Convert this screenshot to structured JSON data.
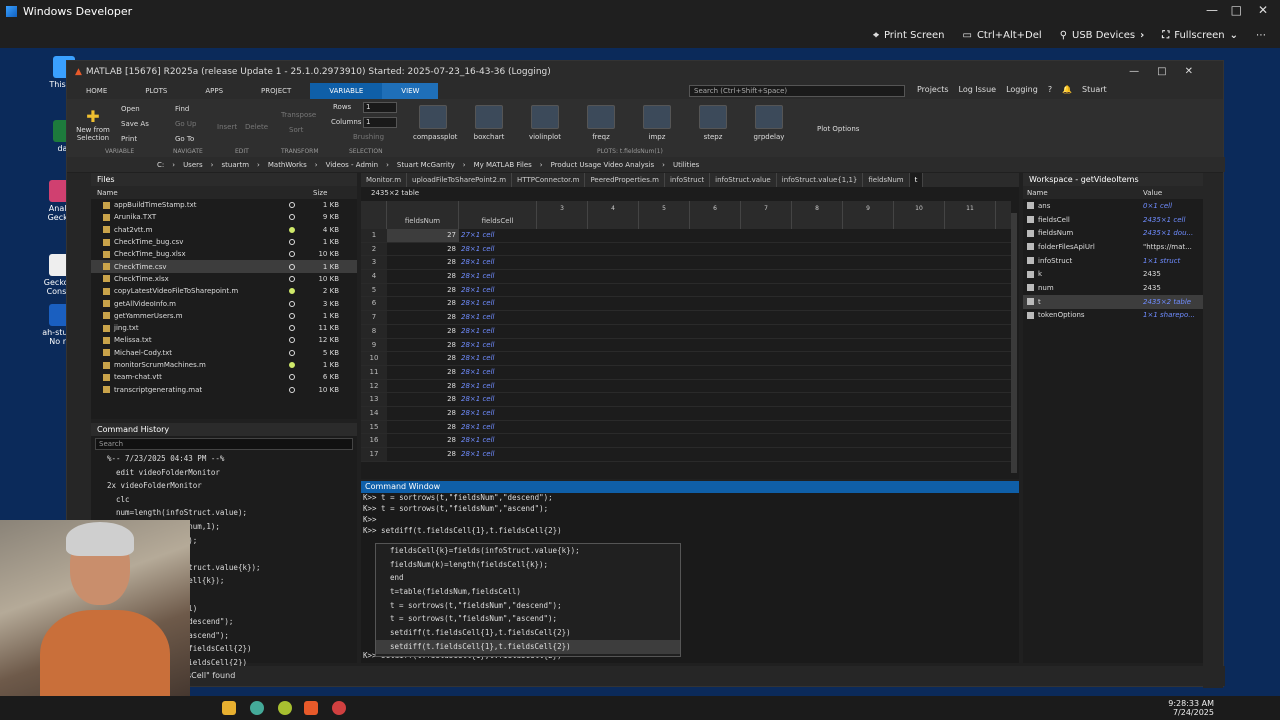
{
  "wd": {
    "title": "Windows Developer",
    "print_screen": "Print Screen",
    "cad": "Ctrl+Alt+Del",
    "usb": "USB Devices",
    "fullscreen": "Fullscreen"
  },
  "desktop": {
    "icons": [
      "This PC",
      "dat",
      "Analy Gecko",
      "Gecko S Consol",
      "ah-stua - No re"
    ]
  },
  "matlab": {
    "title": "MATLAB [15676] R2025a (release Update 1 - 25.1.0.2973910) Started: 2025-07-23_16-43-36 (Logging)",
    "tabs": [
      "HOME",
      "PLOTS",
      "APPS",
      "PROJECT",
      "VARIABLE",
      "VIEW"
    ],
    "search_placeholder": "Search (Ctrl+Shift+Space)",
    "top_right": [
      "Projects",
      "Log Issue",
      "Logging",
      "Stuart"
    ],
    "ribbon": {
      "new_from": "New from",
      "selection": "Selection",
      "open": "Open",
      "find": "Find",
      "save_as": "Save As",
      "goup": "Go Up",
      "print": "Print",
      "goto": "Go To",
      "insert": "Insert",
      "delete": "Delete",
      "transpose": "Transpose",
      "sort": "Sort",
      "rows_label": "Rows",
      "rows_val": "1",
      "cols_label": "Columns",
      "cols_val": "1",
      "brushing": "Brushing",
      "plot_options": "Plot Options",
      "sections": [
        "VARIABLE",
        "NAVIGATE",
        "EDIT",
        "TRANSFORM",
        "SELECTION",
        "PLOTS: t.fieldsNum(1)"
      ],
      "plots": [
        "compassplot",
        "boxchart",
        "violinplot",
        "freqz",
        "impz",
        "stepz",
        "grpdelay"
      ]
    },
    "address": [
      "C:",
      "Users",
      "stuartm",
      "MathWorks",
      "Videos - Admin",
      "Stuart McGarrity",
      "My MATLAB Files",
      "Product Usage Video Analysis",
      "Utilities"
    ]
  },
  "files": {
    "title": "Files",
    "col_name": "Name",
    "col_size": "Size",
    "rows": [
      {
        "n": "appBuildTimeStamp.txt",
        "s": "1 KB",
        "g": false
      },
      {
        "n": "Arunika.TXT",
        "s": "9 KB",
        "g": false
      },
      {
        "n": "chat2vtt.m",
        "s": "4 KB",
        "g": true
      },
      {
        "n": "CheckTime_bug.csv",
        "s": "1 KB",
        "g": false
      },
      {
        "n": "CheckTime_bug.xlsx",
        "s": "10 KB",
        "g": false
      },
      {
        "n": "CheckTime.csv",
        "s": "1 KB",
        "g": false
      },
      {
        "n": "CheckTime.xlsx",
        "s": "10 KB",
        "g": false
      },
      {
        "n": "copyLatestVideoFileToSharepoint.m",
        "s": "2 KB",
        "g": true
      },
      {
        "n": "getAllVideoInfo.m",
        "s": "3 KB",
        "g": false
      },
      {
        "n": "getYammerUsers.m",
        "s": "1 KB",
        "g": false
      },
      {
        "n": "jing.txt",
        "s": "11 KB",
        "g": false
      },
      {
        "n": "Melissa.txt",
        "s": "12 KB",
        "g": false
      },
      {
        "n": "Michael-Cody.txt",
        "s": "5 KB",
        "g": false
      },
      {
        "n": "monitorScrumMachines.m",
        "s": "1 KB",
        "g": true
      },
      {
        "n": "team-chat.vtt",
        "s": "6 KB",
        "g": false
      },
      {
        "n": "transcriptgenerating.mat",
        "s": "10 KB",
        "g": false
      }
    ]
  },
  "history": {
    "title": "Command History",
    "search": "Search",
    "lines": [
      "%-- 7/23/2025 04:43 PM --%",
      "  edit videoFolderMonitor",
      "2x videoFolderMonitor",
      "  clc",
      "  num=length(infoStruct.value);",
      "  fieldsCell=cell(num,1);",
      "           =(num,1);",
      "",
      "         lds(infoStruct.value{k});",
      "         h(fieldsCell{k});",
      "",
      "         fieldsCell)",
      "         ldsNum\",\"descend\");",
      "         ldsNum\",\"ascend\");",
      "         ell{1},t.fieldsCell{2})",
      "         ll{1},t.fieldsCell{2})"
    ],
    "found": "sCell\" found"
  },
  "variables": {
    "tabs": [
      "Monitor.m",
      "uploadFileToSharePoint2.m",
      "HTTPConnector.m",
      "PeeredProperties.m",
      "infoStruct",
      "infoStruct.value",
      "infoStruct.value{1,1}",
      "fieldsNum",
      "t"
    ],
    "size": "2435×2 table",
    "columns": [
      "fieldsNum",
      "fieldsCell",
      "3",
      "4",
      "5",
      "6",
      "7",
      "8",
      "9",
      "10",
      "11"
    ],
    "rows": [
      {
        "r": "1",
        "a": "27",
        "b": "27×1 cell"
      },
      {
        "r": "2",
        "a": "28",
        "b": "28×1 cell"
      },
      {
        "r": "3",
        "a": "28",
        "b": "28×1 cell"
      },
      {
        "r": "4",
        "a": "28",
        "b": "28×1 cell"
      },
      {
        "r": "5",
        "a": "28",
        "b": "28×1 cell"
      },
      {
        "r": "6",
        "a": "28",
        "b": "28×1 cell"
      },
      {
        "r": "7",
        "a": "28",
        "b": "28×1 cell"
      },
      {
        "r": "8",
        "a": "28",
        "b": "28×1 cell"
      },
      {
        "r": "9",
        "a": "28",
        "b": "28×1 cell"
      },
      {
        "r": "10",
        "a": "28",
        "b": "28×1 cell"
      },
      {
        "r": "11",
        "a": "28",
        "b": "28×1 cell"
      },
      {
        "r": "12",
        "a": "28",
        "b": "28×1 cell"
      },
      {
        "r": "13",
        "a": "28",
        "b": "28×1 cell"
      },
      {
        "r": "14",
        "a": "28",
        "b": "28×1 cell"
      },
      {
        "r": "15",
        "a": "28",
        "b": "28×1 cell"
      },
      {
        "r": "16",
        "a": "28",
        "b": "28×1 cell"
      },
      {
        "r": "17",
        "a": "28",
        "b": "28×1 cell"
      }
    ]
  },
  "command": {
    "title": "Command Window",
    "lines": [
      "K>> t = sortrows(t,\"fieldsNum\",\"descend\");",
      "K>> t = sortrows(t,\"fieldsNum\",\"ascend\");",
      "K>>",
      "K>> setdiff(t.fieldsCell{1},t.fieldsCell{2})"
    ],
    "prompt": "K>> setdiff(t.fieldsCell{1},t.fieldsCell{2})",
    "popup": [
      "fieldsCell{k}=fields(infoStruct.value{k});",
      "fieldsNum(k)=length(fieldsCell{k});",
      "end",
      "t=table(fieldsNum,fieldsCell)",
      "t = sortrows(t,\"fieldsNum\",\"descend\");",
      "t = sortrows(t,\"fieldsNum\",\"ascend\");",
      "setdiff(t.fieldsCell{1},t.fieldsCell{2})",
      "setdiff(t.fieldsCell{1},t.fieldsCell{2})"
    ]
  },
  "workspace": {
    "title": "Workspace - getVideoItems",
    "col_name": "Name",
    "col_value": "Value",
    "rows": [
      {
        "n": "ans",
        "v": "0×1 cell",
        "i": true
      },
      {
        "n": "fieldsCell",
        "v": "2435×1 cell",
        "i": true
      },
      {
        "n": "fieldsNum",
        "v": "2435×1 dou...",
        "i": true
      },
      {
        "n": "folderFilesApiUrl",
        "v": "\"https://mat...",
        "i": false
      },
      {
        "n": "infoStruct",
        "v": "1×1 struct",
        "i": true
      },
      {
        "n": "k",
        "v": "2435",
        "i": false
      },
      {
        "n": "num",
        "v": "2435",
        "i": false
      },
      {
        "n": "t",
        "v": "2435×2 table",
        "i": true
      },
      {
        "n": "tokenOptions",
        "v": "1×1 sharepo...",
        "i": true
      }
    ]
  },
  "clock": {
    "time": "9:28:33 AM",
    "date": "7/24/2025"
  }
}
